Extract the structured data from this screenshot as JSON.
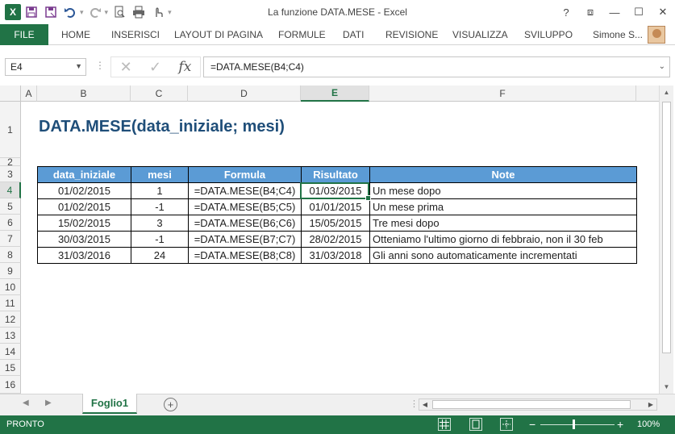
{
  "window": {
    "title": "La funzione DATA.MESE - Excel",
    "help": "?",
    "ribbon_display": "⧈",
    "minimize": "—",
    "maximize": "☐",
    "close": "✕"
  },
  "ribbon": {
    "file": "FILE",
    "tabs": [
      "HOME",
      "INSERISCI",
      "LAYOUT DI PAGINA",
      "FORMULE",
      "DATI",
      "REVISIONE",
      "VISUALIZZA",
      "SVILUPPO"
    ],
    "user": "Simone S..."
  },
  "formula_bar": {
    "name_box": "E4",
    "formula": "=DATA.MESE(B4;C4)",
    "fx": "fx"
  },
  "columns": [
    "A",
    "B",
    "C",
    "D",
    "E",
    "F"
  ],
  "rows": [
    "1",
    "2",
    "3",
    "4",
    "5",
    "6",
    "7",
    "8",
    "9",
    "10",
    "11",
    "12",
    "13",
    "14",
    "15",
    "16"
  ],
  "sheet": {
    "title": "DATA.MESE(data_iniziale; mesi)",
    "table_headers": [
      "data_iniziale",
      "mesi",
      "Formula",
      "Risultato",
      "Note"
    ],
    "table_rows": [
      [
        "01/02/2015",
        "1",
        "=DATA.MESE(B4;C4)",
        "01/03/2015",
        "Un mese dopo"
      ],
      [
        "01/02/2015",
        "-1",
        "=DATA.MESE(B5;C5)",
        "01/01/2015",
        "Un mese prima"
      ],
      [
        "15/02/2015",
        "3",
        "=DATA.MESE(B6;C6)",
        "15/05/2015",
        "Tre mesi dopo"
      ],
      [
        "30/03/2015",
        "-1",
        "=DATA.MESE(B7;C7)",
        "28/02/2015",
        "Otteniamo l'ultimo giorno di febbraio, non il 30 feb"
      ],
      [
        "31/03/2016",
        "24",
        "=DATA.MESE(B8;C8)",
        "31/03/2018",
        "Gli anni sono automaticamente incrementati"
      ]
    ]
  },
  "sheet_tabs": {
    "active": "Foglio1",
    "add": "+"
  },
  "status": {
    "mode": "PRONTO",
    "zoom": "100%",
    "zoom_minus": "−",
    "zoom_plus": "+"
  },
  "colors": {
    "excel_green": "#217346",
    "header_blue": "#5b9bd5",
    "title_blue": "#1f4e79"
  }
}
